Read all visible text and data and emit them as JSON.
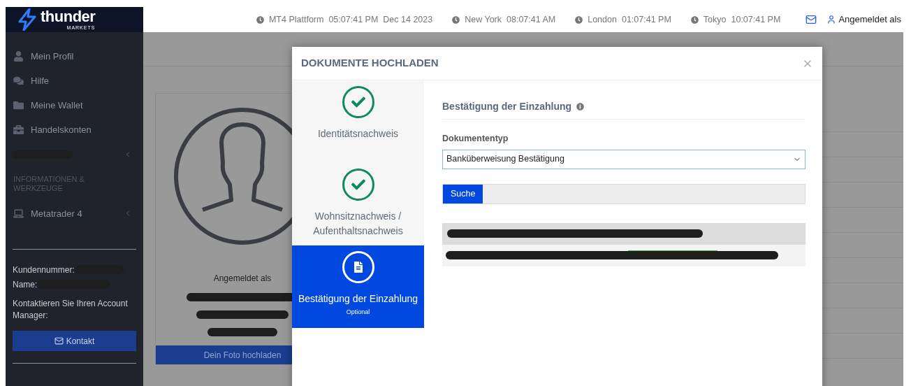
{
  "logo": {
    "text": "thunder",
    "subtext": "MARKETS"
  },
  "clocks": [
    {
      "label": "MT4 Plattform",
      "time": "05:07:41 PM",
      "date": "Dec 14 2023"
    },
    {
      "label": "New York",
      "time": "08:07:41 AM"
    },
    {
      "label": "London",
      "time": "01:07:41 PM"
    },
    {
      "label": "Tokyo",
      "time": "10:07:41 PM"
    }
  ],
  "user_menu": {
    "label": "Angemeldet als"
  },
  "sidebar": {
    "items": [
      {
        "kind": "link",
        "label": "Mein Profil"
      },
      {
        "kind": "link",
        "label": "Hilfe"
      },
      {
        "kind": "link",
        "label": "Meine Wallet"
      },
      {
        "kind": "link",
        "label": "Handelskonten"
      },
      {
        "kind": "redacted"
      }
    ],
    "section_title": "INFORMATIONEN & WERKZEUGE",
    "tools": [
      {
        "kind": "link",
        "label": "Metatrader 4"
      }
    ],
    "customer_number_label": "Kundennummer:",
    "name_label": "Name:",
    "contact_text": "Kontaktieren Sie Ihren Account Manager:",
    "contact_button": "Kontakt"
  },
  "profile_card": {
    "caption": "Angemeldet als",
    "upload_button": "Dein Foto hochladen"
  },
  "modal": {
    "title": "DOKUMENTE HOCHLADEN",
    "steps": [
      {
        "label": "Identitätsnachweis",
        "completed": true,
        "selected": false
      },
      {
        "label": "Wohnsitznachweis / Aufenthaltsnachweis",
        "completed": true,
        "selected": false
      },
      {
        "label": "Bestätigung der Einzahlung",
        "note": "Optional",
        "completed": false,
        "selected": true
      }
    ],
    "section_title": "Bestätigung der Einzahlung",
    "field_label": "Dokumententyp",
    "select_value": "Banküberweisung Bestätigung",
    "search_button": "Suche"
  }
}
